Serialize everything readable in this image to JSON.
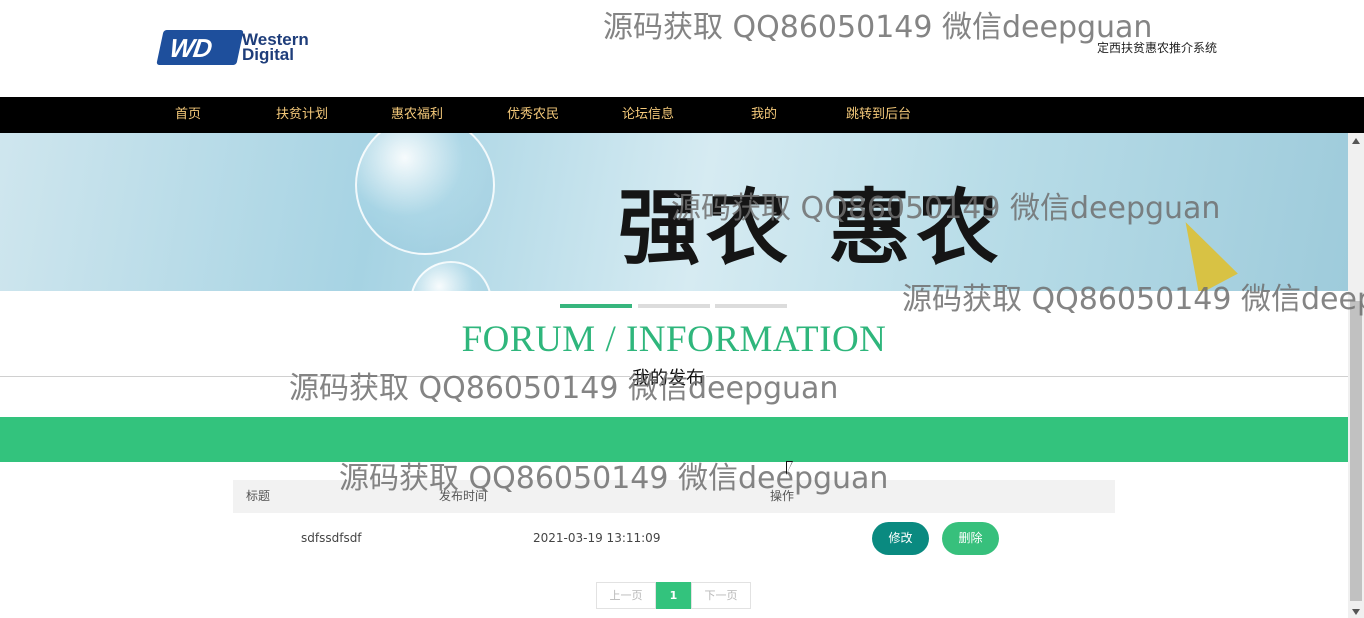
{
  "header": {
    "logo_mark": "WD",
    "logo_line1": "Western",
    "logo_line2": "Digital",
    "site_title": "定西扶贫惠农推介系统"
  },
  "nav": {
    "items": [
      "首页",
      "扶贫计划",
      "惠农福利",
      "优秀农民",
      "论坛信息",
      "我的",
      "跳转到后台"
    ]
  },
  "banner": {
    "text": "强农 惠农"
  },
  "carousel": {
    "dots": 3,
    "active_index": 0
  },
  "section": {
    "title": "FORUM / INFORMATION",
    "subtitle": "我的发布"
  },
  "table": {
    "columns": [
      "标题",
      "发布时间",
      "操作"
    ],
    "rows": [
      {
        "title": "sdfssdfsdf",
        "time": "2021-03-19 13:11:09",
        "edit": "修改",
        "delete": "删除"
      }
    ]
  },
  "pagination": {
    "prev": "上一页",
    "current": "1",
    "next": "下一页"
  },
  "watermark": {
    "text": "源码获取 QQ86050149 微信deepguan"
  },
  "colors": {
    "accent": "#33c37d",
    "nav_bg": "#000000",
    "nav_text": "#f4c97a",
    "edit_button": "#0a8a80",
    "delete_button": "#37c07c"
  }
}
